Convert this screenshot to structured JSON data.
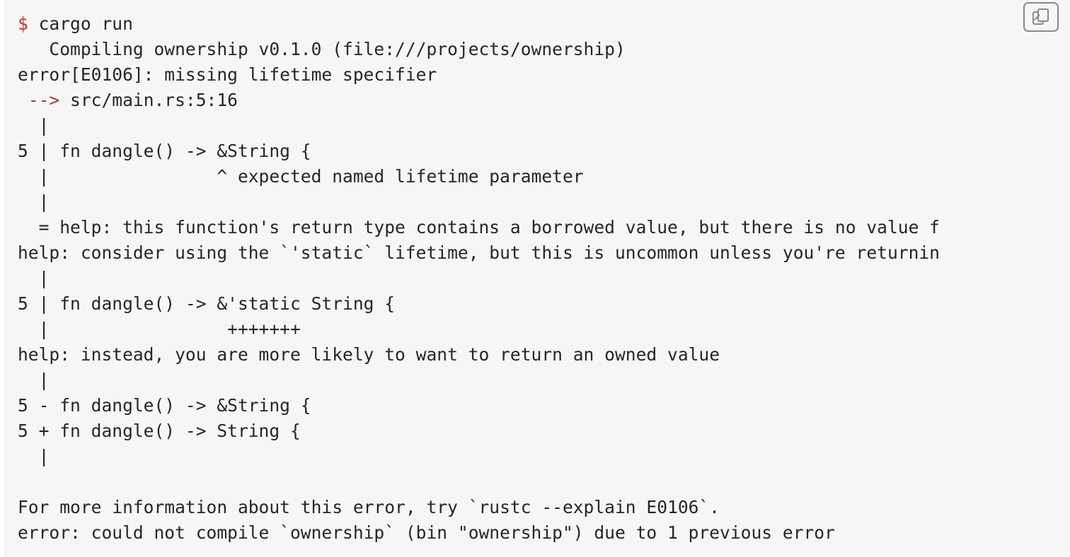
{
  "terminal": {
    "prompt": "$",
    "command": " cargo run",
    "arrow": "-->",
    "lines": [
      "   Compiling ownership v0.1.0 (file:///projects/ownership)",
      "error[E0106]: missing lifetime specifier",
      " src/main.rs:5:16",
      "  |",
      "5 | fn dangle() -> &String {",
      "  |                ^ expected named lifetime parameter",
      "  |",
      "  = help: this function's return type contains a borrowed value, but there is no value f",
      "help: consider using the `'static` lifetime, but this is uncommon unless you're returnin",
      "  |",
      "5 | fn dangle() -> &'static String {",
      "  |                 +++++++",
      "help: instead, you are more likely to want to return an owned value",
      "  |",
      "5 - fn dangle() -> &String {",
      "5 + fn dangle() -> String {",
      "  |",
      "",
      "For more information about this error, try `rustc --explain E0106`.",
      "error: could not compile `ownership` (bin \"ownership\") due to 1 previous error"
    ]
  },
  "copy_button": {
    "icon": "copy-icon",
    "border_color": "#8a8a8a"
  },
  "colors": {
    "background": "#f6f6f6",
    "text": "#262626",
    "prompt": "#c0392b"
  }
}
